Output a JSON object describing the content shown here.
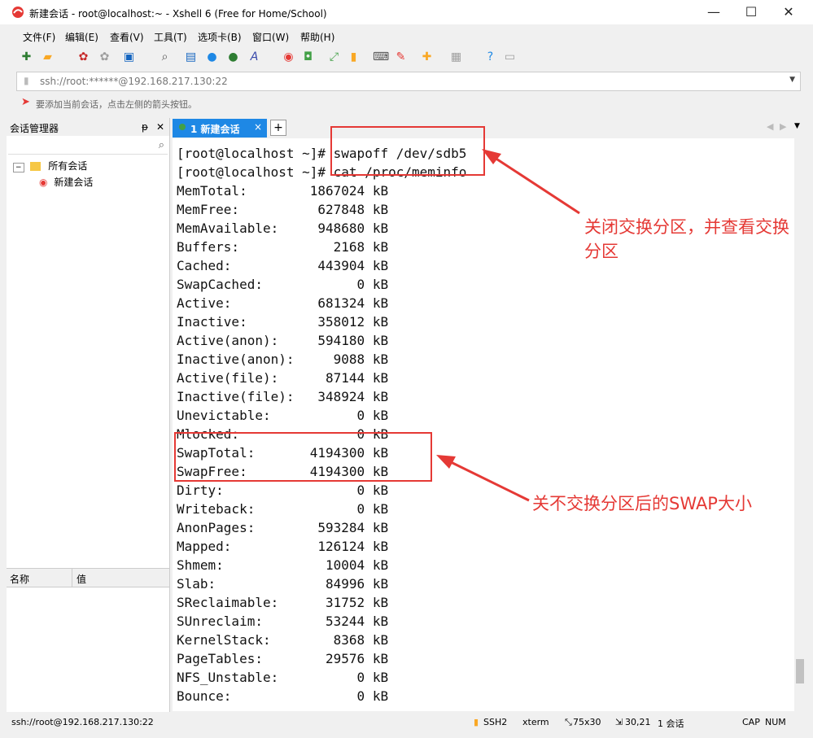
{
  "window": {
    "title": "新建会话 - root@localhost:~ - Xshell 6 (Free for Home/School)",
    "minimize": "—",
    "maximize": "☐",
    "close": "✕"
  },
  "menu": [
    "文件(F)",
    "编辑(E)",
    "查看(V)",
    "工具(T)",
    "选项卡(B)",
    "窗口(W)",
    "帮助(H)"
  ],
  "address": "ssh://root:******@192.168.217.130:22",
  "hint": "要添加当前会话，点击左侧的箭头按钮。",
  "session_manager": {
    "title": "会话管理器",
    "pin": "ᵽ",
    "close": "✕",
    "root": "所有会话",
    "child": "新建会话",
    "prop_name": "名称",
    "prop_value": "值"
  },
  "tab": {
    "label": "1 新建会话",
    "close": "×",
    "add": "+"
  },
  "terminal_lines": [
    "[root@localhost ~]# swapoff /dev/sdb5",
    "[root@localhost ~]# cat /proc/meminfo",
    "MemTotal:        1867024 kB",
    "MemFree:          627848 kB",
    "MemAvailable:     948680 kB",
    "Buffers:            2168 kB",
    "Cached:           443904 kB",
    "SwapCached:            0 kB",
    "Active:           681324 kB",
    "Inactive:         358012 kB",
    "Active(anon):     594180 kB",
    "Inactive(anon):     9088 kB",
    "Active(file):      87144 kB",
    "Inactive(file):   348924 kB",
    "Unevictable:           0 kB",
    "Mlocked:               0 kB",
    "SwapTotal:       4194300 kB",
    "SwapFree:        4194300 kB",
    "Dirty:                 0 kB",
    "Writeback:             0 kB",
    "AnonPages:        593284 kB",
    "Mapped:           126124 kB",
    "Shmem:             10004 kB",
    "Slab:              84996 kB",
    "SReclaimable:      31752 kB",
    "SUnreclaim:        53244 kB",
    "KernelStack:        8368 kB",
    "PageTables:        29576 kB",
    "NFS_Unstable:          0 kB",
    "Bounce:                0 kB"
  ],
  "annotations": {
    "note1": "关闭交换分区，并查看交换分区",
    "note2": "关不交换分区后的SWAP大小"
  },
  "status": {
    "conn": "ssh://root@192.168.217.130:22",
    "proto": "SSH2",
    "term": "xterm",
    "size": "75x30",
    "pos": "30,21",
    "sessions": "1 会话",
    "caps": "CAP",
    "num": "NUM"
  },
  "colors": {
    "accent": "#1e88e5",
    "annotation": "#e53935"
  }
}
